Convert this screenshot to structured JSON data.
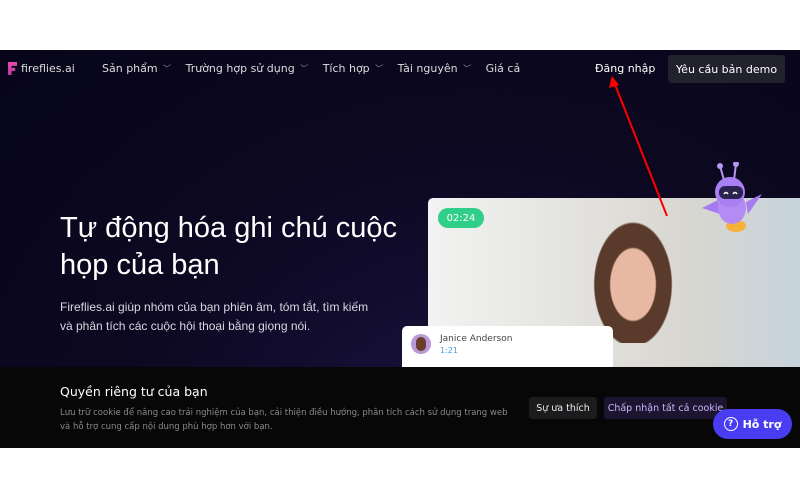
{
  "nav": {
    "logo": "fireflies.ai",
    "items": [
      {
        "label": "Sản phẩm"
      },
      {
        "label": "Trường hợp sử dụng"
      },
      {
        "label": "Tích hợp"
      },
      {
        "label": "Tài nguyên"
      },
      {
        "label": "Giá cả"
      }
    ],
    "login": "Đăng nhập",
    "demo": "Yêu cầu bản demo"
  },
  "hero": {
    "title": "Tự động hóa ghi chú cuộc họp của bạn",
    "subtitle": "Fireflies.ai giúp nhóm của bạn phiên âm, tóm tắt, tìm kiếm và phân tích các cuộc hội thoại bằng giọng nói.",
    "timer": "02:24",
    "transcript": {
      "name": "Janice Anderson",
      "time": "1:21"
    }
  },
  "cookie": {
    "title": "Quyền riêng tư của bạn",
    "text": "Lưu trữ cookie để nâng cao trải nghiệm của bạn, cải thiện điều hướng, phân tích cách sử dụng trang web và hỗ trợ cung cấp nội dung phù hợp hơn với bạn.",
    "preferences": "Sự ưa thích",
    "accept": "Chấp nhận tất cả cookie"
  },
  "help": {
    "label": "Hỗ trợ",
    "icon": "question-circle-icon"
  },
  "colors": {
    "accent": "#4a3cf0",
    "timer": "#2fcf8a",
    "annotation_arrow": "#ff0000"
  }
}
